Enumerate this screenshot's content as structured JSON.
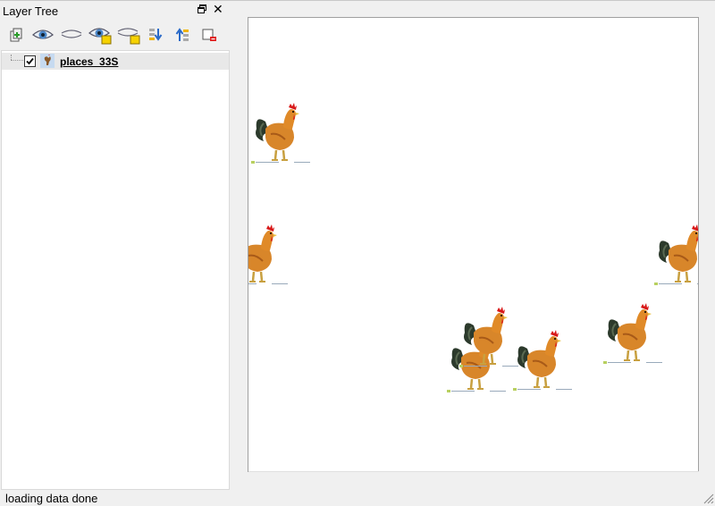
{
  "dock": {
    "title": "Layer Tree",
    "float_icon": "restore-window-icon",
    "close_label": "✕"
  },
  "toolbar": {
    "buttons": [
      {
        "name": "add-layer-button",
        "icon": "add-layer-icon"
      },
      {
        "name": "show-all-layers-button",
        "icon": "eye-open-icon"
      },
      {
        "name": "hide-all-layers-button",
        "icon": "eye-closed-icon"
      },
      {
        "name": "show-selected-layers-button",
        "icon": "eye-open-selected-icon"
      },
      {
        "name": "hide-selected-layers-button",
        "icon": "eye-closed-selected-icon"
      },
      {
        "name": "move-layer-down-button",
        "icon": "arrow-down-icon"
      },
      {
        "name": "move-layer-up-button",
        "icon": "arrow-up-icon"
      },
      {
        "name": "remove-layer-button",
        "icon": "remove-layer-icon"
      }
    ]
  },
  "tree": {
    "layers": [
      {
        "label": "places_33S",
        "checked": true,
        "icon": "point-layer-icon"
      }
    ]
  },
  "map": {
    "symbol_icon": "rooster-icon"
  },
  "status": {
    "text": "loading data done"
  },
  "colors": {
    "panel_bg": "#f0f0f0",
    "canvas_bg": "#ffffff",
    "selected_row": "#e8e8e8"
  }
}
